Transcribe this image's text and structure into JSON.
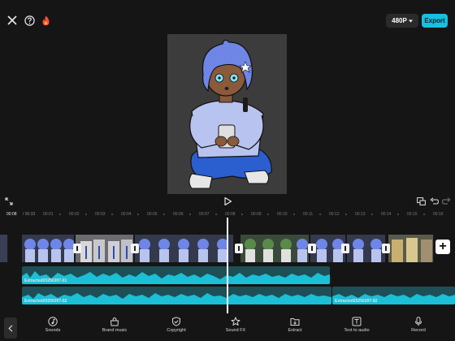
{
  "header": {
    "resolution_label": "480P",
    "export_label": "Export"
  },
  "timeline": {
    "current_time": "00:08",
    "total_time": "/ 00:33",
    "ticks": [
      "00:01",
      "00:02",
      "00:03",
      "00:04",
      "00:05",
      "00:06",
      "00:07",
      "00:08",
      "00:09",
      "00:10",
      "00:11",
      "00:12",
      "00:13",
      "00:14",
      "00:15",
      "00:16"
    ],
    "audio_tracks": [
      {
        "label": "Extracted20250207-01"
      },
      {
        "label": "Extracted20250207-02"
      },
      {
        "label": "Extracted20250207-02"
      }
    ]
  },
  "toolbar": {
    "items": [
      {
        "label": "Sounds",
        "icon": "music-note-icon"
      },
      {
        "label": "Brand music",
        "icon": "music-bag-icon"
      },
      {
        "label": "Copyright",
        "icon": "shield-check-icon"
      },
      {
        "label": "Sound FX",
        "icon": "star-sparkle-icon"
      },
      {
        "label": "Extract",
        "icon": "folder-icon"
      },
      {
        "label": "Text to audio",
        "icon": "text-audio-icon"
      },
      {
        "label": "Record",
        "icon": "microphone-icon"
      }
    ]
  },
  "colors": {
    "accent": "#16c0e3",
    "background": "#151515",
    "audio_wave": "#1bbfd6"
  }
}
